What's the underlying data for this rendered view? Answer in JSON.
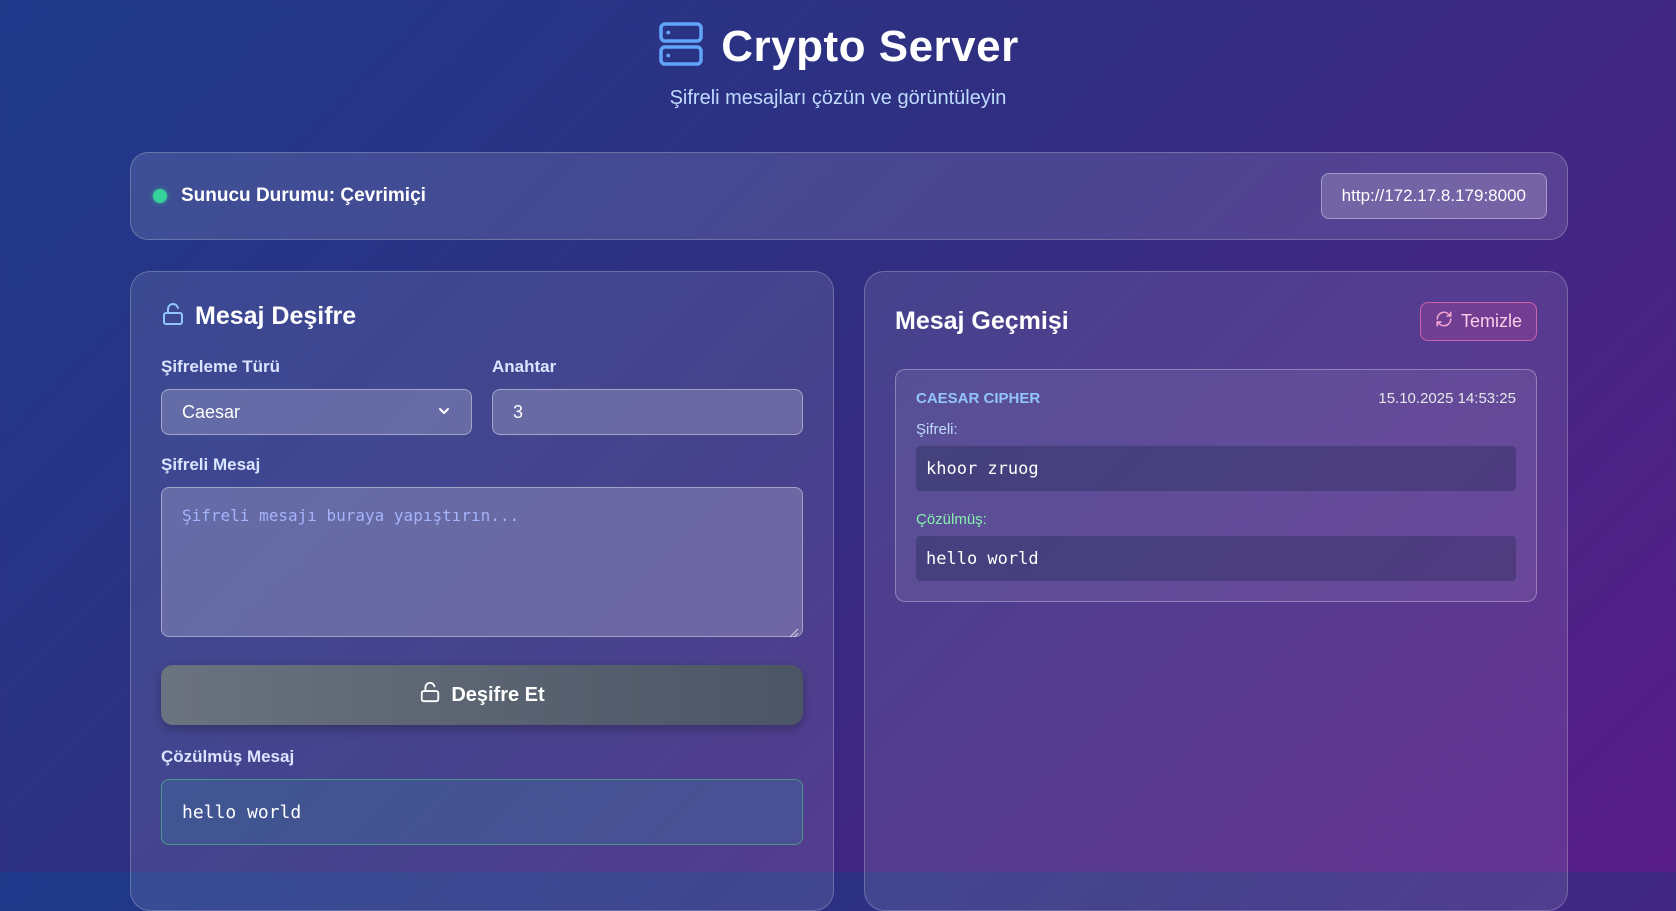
{
  "header": {
    "icon": "server-icon",
    "title": "Crypto Server",
    "subtitle": "Şifreli mesajları çözün ve görüntüleyin"
  },
  "status": {
    "text": "Sunucu Durumu: Çevrimiçi",
    "dot_color": "#34d399",
    "server_url": "http://172.17.8.179:8000"
  },
  "decrypt_panel": {
    "title": "Mesaj Deşifre",
    "cipher_type_label": "Şifreleme Türü",
    "cipher_type_value": "Caesar",
    "key_label": "Anahtar",
    "key_value": "3",
    "encrypted_label": "Şifreli Mesaj",
    "encrypted_placeholder": "Şifreli mesajı buraya yapıştırın...",
    "decrypt_button": "Deşifre Et",
    "result_label": "Çözülmüş Mesaj",
    "result_value": "hello world"
  },
  "history_panel": {
    "title": "Mesaj Geçmişi",
    "clear_button": "Temizle",
    "items": [
      {
        "cipher": "CAESAR CIPHER",
        "timestamp": "15.10.2025 14:53:25",
        "encrypted_label": "Şifreli:",
        "encrypted": "khoor zruog",
        "decrypted_label": "Çözülmüş:",
        "decrypted": "hello world"
      }
    ]
  },
  "colors": {
    "accent_blue": "#60a5fa",
    "success_green": "#34d399",
    "clear_pink": "#f472b6"
  }
}
